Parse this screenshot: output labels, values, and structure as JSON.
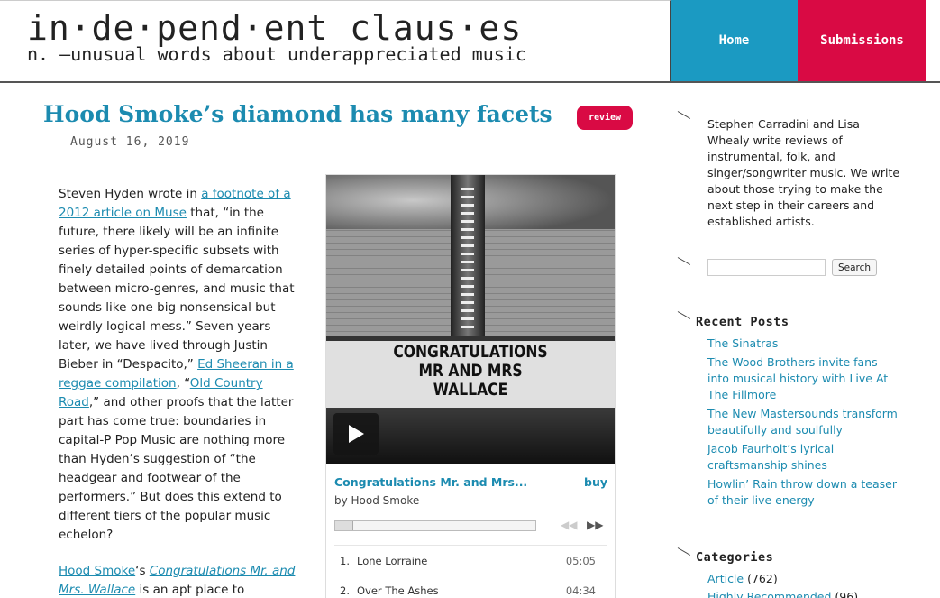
{
  "header": {
    "site_title": "in·de·pend·ent claus·es",
    "tagline": "n. —unusual words about underappreciated music",
    "nav_home": "Home",
    "nav_submissions": "Submissions",
    "home_color": "#1b9ac2",
    "submissions_color": "#d90a44"
  },
  "post": {
    "title": "Hood Smoke’s diamond has many facets",
    "badge": "review",
    "date": "August 16, 2019",
    "p1": {
      "t1": "Steven Hyden wrote in ",
      "link1": "a footnote of a 2012 article on Muse",
      "t2": " that, “in the future, there likely will be an infinite series of hyper-specific subsets with finely detailed points of demarcation between micro-genres, and music that sounds like one big nonsensical but weirdly logical mess.” Seven years later, we have lived through Justin Bieber in “Despacito,” ",
      "link2": "Ed Sheeran in a reggae compilation",
      "t3": ", “",
      "link3": "Old Country Road",
      "t4": ",” and other proofs that the latter part has come true: boundaries in capital-P Pop Music are nothing more than Hyden’s suggestion of “the headgear and footwear of the performers.” But does this extend to different tiers of the popular music echelon?"
    },
    "p2": {
      "link1": "Hood Smoke",
      "t1": "‘s ",
      "link2": "Congratulations Mr. and Mrs. Wallace",
      "t2": " is an apt place to"
    }
  },
  "player": {
    "marquee_line1": "CONGRATULATIONS",
    "marquee_line2": "MR AND MRS",
    "marquee_line3": "WALLACE",
    "track_title": "Congratulations Mr. and Mrs...",
    "buy": "buy",
    "artist": "by Hood Smoke",
    "progress": 0.0,
    "tracks": [
      {
        "num": "1.",
        "name": "Lone Lorraine",
        "time": "05:05"
      },
      {
        "num": "2.",
        "name": "Over The Ashes",
        "time": "04:34"
      }
    ]
  },
  "sidebar": {
    "about": "Stephen Carradini and Lisa Whealy write reviews of instrumental, folk, and singer/songwriter music. We write about those trying to make the next step in their careers and established artists.",
    "search_button": "Search",
    "search_placeholder": "",
    "recent_heading": "Recent Posts",
    "recent": [
      "The Sinatras",
      "The Wood Brothers invite fans into musical history with Live At The Fillmore",
      "The New Mastersounds transform beautifully and soulfully",
      "Jacob Faurholt’s lyrical craftsmanship shines",
      "Howlin’ Rain throw down a teaser of their live energy"
    ],
    "categories_heading": "Categories",
    "categories": [
      {
        "name": "Article",
        "count": "(762)"
      },
      {
        "name": "Highly Recommended",
        "count": "(96)"
      }
    ]
  }
}
